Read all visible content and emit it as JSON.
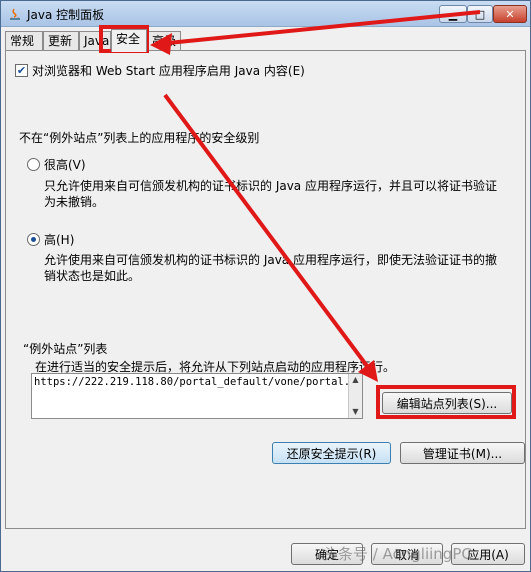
{
  "window": {
    "title": "Java 控制面板"
  },
  "tabs": [
    "常规",
    "更新",
    "Java",
    "安全",
    "高级"
  ],
  "checkbox": {
    "label": "对浏览器和 Web Start 应用程序启用 Java 内容(E)",
    "checked": true
  },
  "security_level": {
    "heading": "不在“例外站点”列表上的应用程序的安全级别",
    "options": [
      {
        "label": "很高(V)",
        "desc": "只允许使用来自可信颁发机构的证书标识的 Java 应用程序运行，并且可以将证书验证为未撤销。"
      },
      {
        "label": "高(H)",
        "desc": "允许使用来自可信颁发机构的证书标识的 Java 应用程序运行，即使无法验证证书的撤销状态也是如此。"
      }
    ]
  },
  "exception": {
    "heading": "“例外站点”列表",
    "desc": "在进行适当的安全提示后，将允许从下列站点启动的应用程序运行。",
    "sites": [
      "https://222.219.118.80/portal_default/vone/portal..."
    ],
    "edit_button": "编辑站点列表(S)..."
  },
  "buttons": {
    "restore": "还原安全提示(R)",
    "manage": "管理证书(M)...",
    "ok": "确定",
    "cancel": "取消",
    "apply": "应用(A)"
  },
  "watermark": "头条号 / AongliingPC"
}
